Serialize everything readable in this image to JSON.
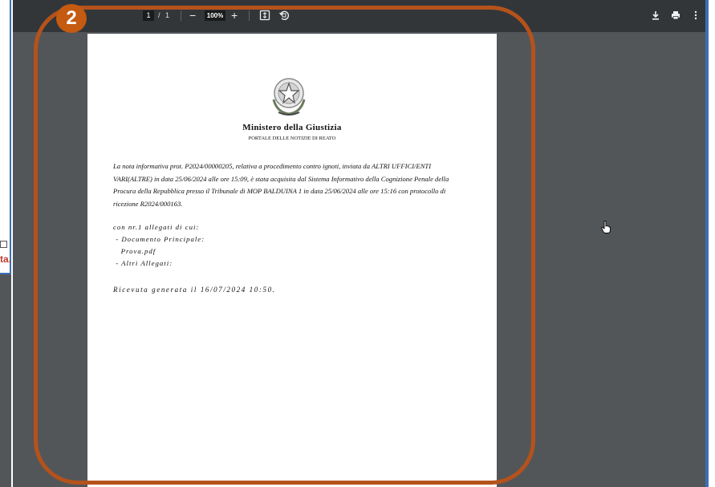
{
  "background": {
    "fragment_text": "ta."
  },
  "toolbar": {
    "page_current": "1",
    "page_separator": "/",
    "page_total": "1",
    "zoom_out": "−",
    "zoom_value": "100%",
    "zoom_in": "+",
    "icons": [
      "fit-page-icon",
      "rotate-icon",
      "download-icon",
      "print-icon",
      "more-icon"
    ]
  },
  "document": {
    "emblem": "italian-republic-emblem",
    "ministry": "Ministero della Giustizia",
    "portal": "PORTALE DELLE NOTIZIE DI REATO",
    "note": "La nota informativa prot. P2024/00000205, relativa a procedimento contro ignoti, inviata da ALTRI UFFICI/ENTI VARI(ALTRE) in data 25/06/2024 alle ore 15:09, è stata acquisita dal Sistema Informativo della Cognizione Penale della Procura della Repubblica presso il Tribunale di MOP BALDUINA 1 in data 25/06/2024 alle ore 15:16 con protocollo di ricezione R2024/000163.",
    "attachments_intro": "con nr.1 allegati di cui:",
    "attachments": [
      " - Documento Principale:",
      "   Prova.pdf",
      " - Altri Allegati:"
    ],
    "receipt": "Ricevuta generata il 16/07/2024 10:50."
  },
  "annotation": {
    "badge_number": "2",
    "color": "#c55a11"
  }
}
